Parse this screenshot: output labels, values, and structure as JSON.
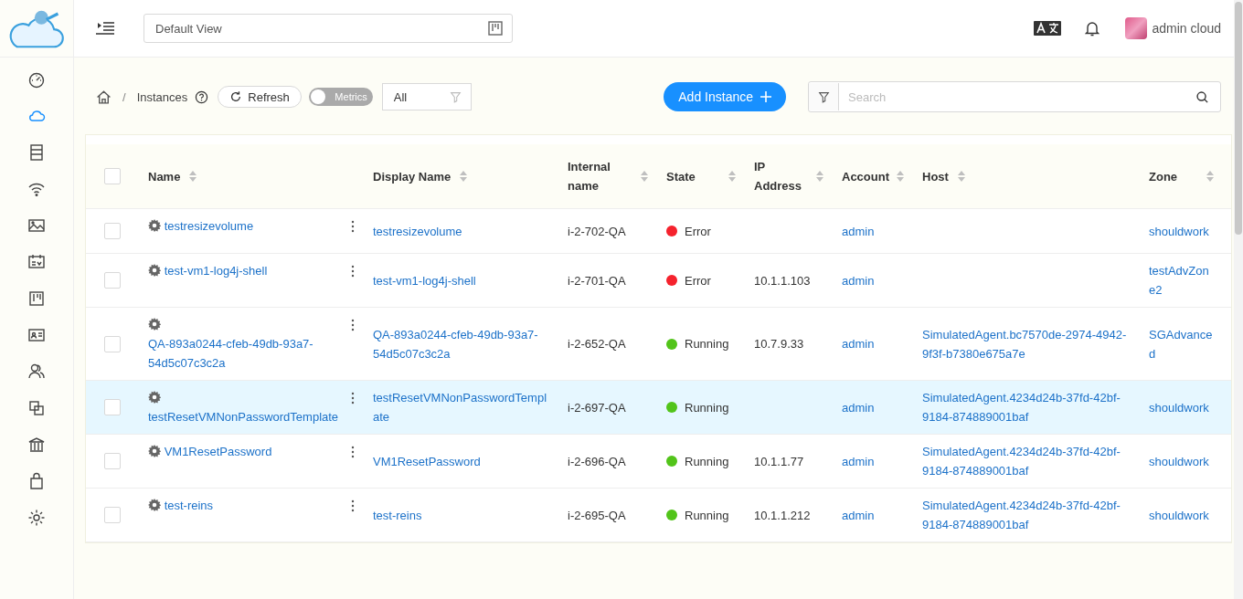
{
  "sidebar": {
    "items": [
      {
        "selected": false
      },
      {
        "selected": true
      },
      {
        "selected": false
      },
      {
        "selected": false
      },
      {
        "selected": false
      },
      {
        "selected": false
      },
      {
        "selected": false
      },
      {
        "selected": false
      },
      {
        "selected": false
      },
      {
        "selected": false
      },
      {
        "selected": false
      },
      {
        "selected": false
      },
      {
        "selected": false
      }
    ]
  },
  "header": {
    "view_selector": {
      "value": "Default View"
    },
    "user": {
      "name": "admin cloud"
    }
  },
  "toolbar": {
    "breadcrumb_separator": "/",
    "breadcrumb": "Instances",
    "refresh": "Refresh",
    "metrics": {
      "label": "Metrics",
      "on": false
    },
    "filter": {
      "value": "All"
    },
    "add_button": "Add Instance",
    "search": {
      "placeholder": "Search"
    }
  },
  "table": {
    "all_checked": false,
    "columns": [
      "Name",
      "Display Name",
      "Internal name",
      "State",
      "IP Address",
      "Account",
      "Host",
      "Zone"
    ],
    "rows": [
      {
        "selected": false,
        "checked": false,
        "name": "testresizevolume",
        "display_name": "testresizevolume",
        "internal_name": "i-2-702-QA",
        "state": "Error",
        "color": "#f5222d",
        "ip": "",
        "account": "admin",
        "host": "",
        "zone": "shouldwork"
      },
      {
        "selected": false,
        "checked": false,
        "name": "test-vm1-log4j-shell",
        "display_name": "test-vm1-log4j-shell",
        "internal_name": "i-2-701-QA",
        "state": "Error",
        "color": "#f5222d",
        "ip": "10.1.1.103",
        "account": "admin",
        "host": "",
        "zone": "testAdvZone2"
      },
      {
        "selected": false,
        "checked": false,
        "name": "QA-893a0244-cfeb-49db-93a7-54d5c07c3c2a",
        "display_name": "QA-893a0244-cfeb-49db-93a7-54d5c07c3c2a",
        "internal_name": "i-2-652-QA",
        "state": "Running",
        "color": "#52c41a",
        "ip": "10.7.9.33",
        "account": "admin",
        "host": "SimulatedAgent.bc7570de-2974-4942-9f3f-b7380e675a7e",
        "zone": "SGAdvanced"
      },
      {
        "selected": true,
        "checked": false,
        "name": "testResetVMNonPasswordTemplate",
        "display_name": "testResetVMNonPasswordTemplate",
        "internal_name": "i-2-697-QA",
        "state": "Running",
        "color": "#52c41a",
        "ip": "",
        "account": "admin",
        "host": "SimulatedAgent.4234d24b-37fd-42bf-9184-874889001baf",
        "zone": "shouldwork"
      },
      {
        "selected": false,
        "checked": false,
        "name": "VM1ResetPassword",
        "display_name": "VM1ResetPassword",
        "internal_name": "i-2-696-QA",
        "state": "Running",
        "color": "#52c41a",
        "ip": "10.1.1.77",
        "account": "admin",
        "host": "SimulatedAgent.4234d24b-37fd-42bf-9184-874889001baf",
        "zone": "shouldwork"
      },
      {
        "selected": false,
        "checked": false,
        "name": "test-reins",
        "display_name": "test-reins",
        "internal_name": "i-2-695-QA",
        "state": "Running",
        "color": "#52c41a",
        "ip": "10.1.1.212",
        "account": "admin",
        "host": "SimulatedAgent.4234d24b-37fd-42bf-9184-874889001baf",
        "zone": "shouldwork"
      }
    ]
  }
}
